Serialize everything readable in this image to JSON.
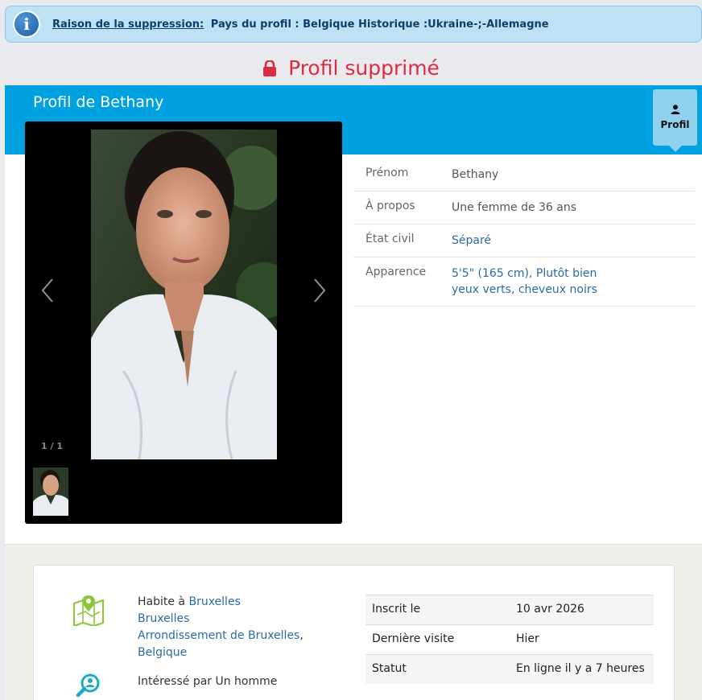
{
  "notice": {
    "label": "Raison de la suppression:",
    "text": "Pays du profil : Belgique Historique :Ukraine-;-Allemagne",
    "icon": "info-icon"
  },
  "status": {
    "title": "Profil supprimé",
    "icon": "lock-icon",
    "color": "#dc2c44"
  },
  "header": {
    "title": "Profil de Bethany",
    "tab_label": "Profil",
    "tab_icon": "user-icon",
    "band_color": "#00a1e0"
  },
  "gallery": {
    "counter": "1 / 1",
    "prev_icon": "chevron-left-icon",
    "next_icon": "chevron-right-icon"
  },
  "details": [
    {
      "key": "Prénom",
      "value": "Bethany",
      "link": false
    },
    {
      "key": "À propos",
      "value": "Une femme de 36 ans",
      "link": false
    },
    {
      "key": "État civil",
      "value": "Séparé",
      "link": true
    },
    {
      "key": "Apparence",
      "value": "5'5\" (165 cm), Plutôt bien",
      "value2": "yeux verts, cheveux noirs",
      "link": true
    }
  ],
  "location": {
    "prefix": "Habite à",
    "city": "Bruxelles",
    "region": "Bruxelles",
    "district": "Arrondissement de Bruxelles",
    "separator": ",",
    "country": "Belgique",
    "icon": "map-pin-icon"
  },
  "interest": {
    "text": "Intéressé par Un homme",
    "icon": "search-user-icon"
  },
  "stats": [
    {
      "key": "Inscrit le",
      "value": "10 avr 2026"
    },
    {
      "key": "Dernière visite",
      "value": "Hier"
    },
    {
      "key": "Statut",
      "value": "En ligne il y a 7 heures"
    }
  ]
}
